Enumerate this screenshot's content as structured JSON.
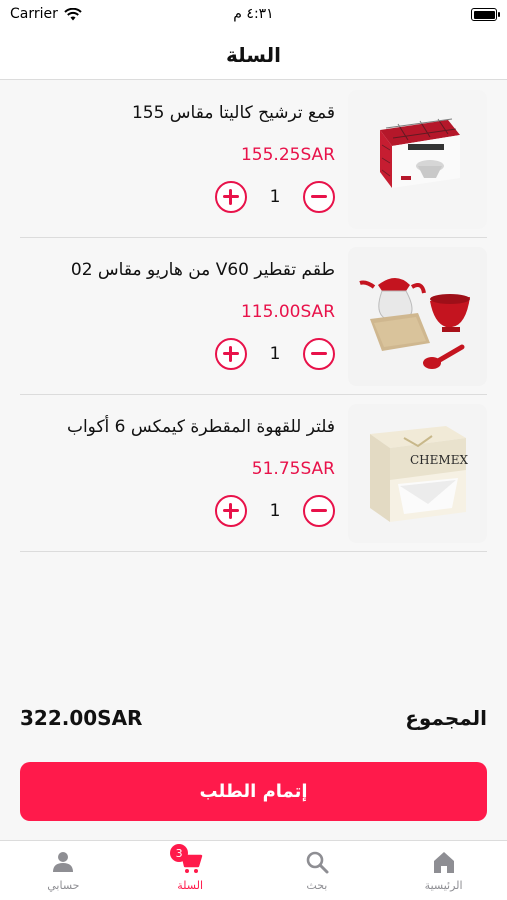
{
  "status_bar": {
    "carrier": "Carrier",
    "time": "٤:٣١ م"
  },
  "header": {
    "title": "السلة"
  },
  "cart": {
    "items": [
      {
        "name": "قمع ترشيح كاليتا مقاس 155",
        "price": "155.25SAR",
        "quantity": "1",
        "image_icon": "dripper-box-image"
      },
      {
        "name": "طقم تقطير V60 من هاريو مقاس 02",
        "price": "115.00SAR",
        "quantity": "1",
        "image_icon": "v60-set-image"
      },
      {
        "name": "فلتر للقهوة المقطرة كيمكس 6 أكواب",
        "price": "51.75SAR",
        "quantity": "1",
        "image_icon": "chemex-filter-box-image",
        "box_brand": "CHEMEX"
      }
    ]
  },
  "summary": {
    "total_label": "المجموع",
    "total_amount": "322.00SAR"
  },
  "checkout": {
    "label": "إتمام الطلب"
  },
  "tab_bar": {
    "tabs": [
      {
        "label": "حسابي",
        "icon": "person-icon"
      },
      {
        "label": "السلة",
        "icon": "cart-icon",
        "badge": "3",
        "active": true
      },
      {
        "label": "بحث",
        "icon": "search-icon"
      },
      {
        "label": "الرئيسية",
        "icon": "home-icon"
      }
    ]
  },
  "colors": {
    "accent": "#ff1a4b",
    "price": "#e8124a",
    "inactive": "#8e8e93"
  }
}
